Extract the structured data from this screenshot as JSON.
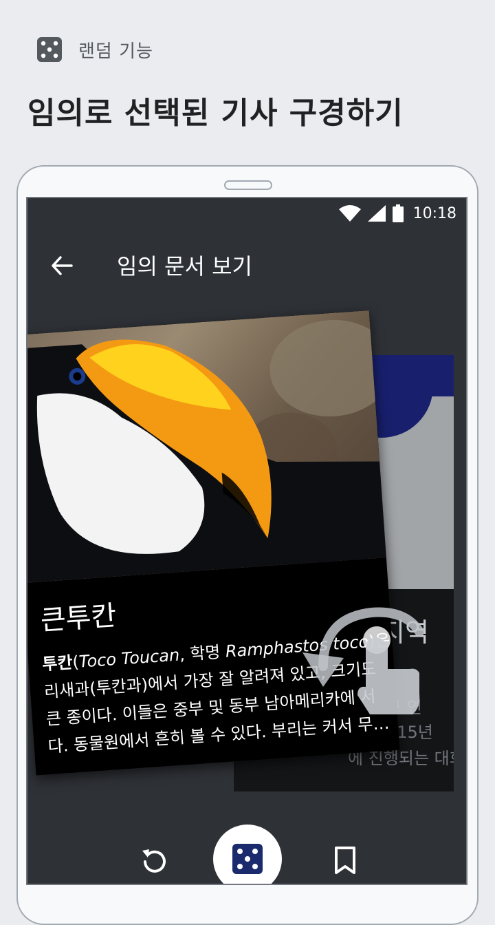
{
  "feature": {
    "icon": "dice-icon",
    "label": "랜덤 기능"
  },
  "headline": "임의로 선택된 기사 구경하기",
  "device": {
    "status_bar": {
      "time": "10:18",
      "icons": [
        "wifi-icon",
        "signal-icon",
        "battery-icon"
      ]
    },
    "app_bar": {
      "back_icon": "arrow-left-icon",
      "title": "임의 문서 보기"
    },
    "front_card": {
      "title": "큰투칸",
      "lines": [
        {
          "bold": "투칸",
          "normal": "(",
          "italic1": "Toco Toucan",
          "mid": ", 학명 ",
          "italic2": "Ramphastos toco",
          "tail": ")은"
        },
        {
          "text": "리새과(투칸과)에서 가장 잘 알려져 있고, 크기도"
        },
        {
          "text": "큰 종이다. 이들은 중부 및 동부 남아메리카에 서"
        },
        {
          "text": "다. 동물원에서 흔히 볼 수 있다. 부리는 커서 무…"
        }
      ]
    },
    "back_card": {
      "title": "지역",
      "lines": [
        "구 연",
        "015년",
        "에 진행되는 대회"
      ]
    },
    "swipe_hint_icon": "swipe-gesture-icon",
    "bottom_actions": {
      "refresh_icon": "refresh-icon",
      "random_icon": "dice-icon",
      "bookmark_icon": "bookmark-icon"
    }
  },
  "colors": {
    "background": "#eaecf0",
    "screen": "#2e3136",
    "dice_accent": "#1a2a6c"
  }
}
